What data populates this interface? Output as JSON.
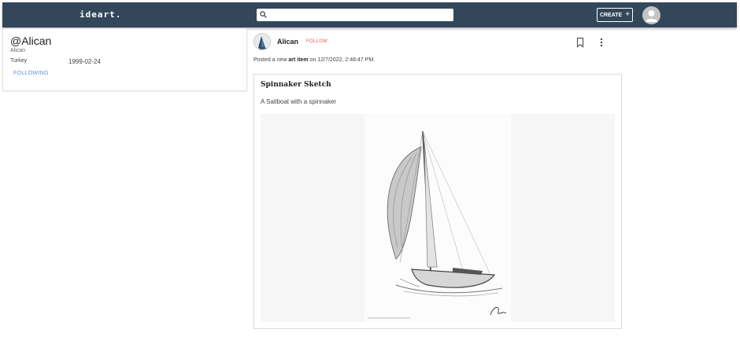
{
  "app": {
    "logo": "ideart."
  },
  "header": {
    "search_placeholder": "",
    "create_label": "CREATE",
    "create_plus": "+"
  },
  "profile": {
    "handle": "@Alican",
    "name": "Alican",
    "country": "Turkey",
    "birthdate": "1999-02-24",
    "following_label": "FOLLOWING"
  },
  "post": {
    "author": "Alican",
    "follow_label": "FOLLOW",
    "posted_prefix": "Posted a new",
    "item_type": "art item",
    "posted_on": "on 12/7/2022, 2:48:47 PM.",
    "art": {
      "title": "Spinnaker Sketch",
      "description": "A Sailboat with a spinnaker",
      "image_semantic": "sailboat-sketch-image"
    }
  },
  "colors": {
    "topbar": "#33475b",
    "following": "#5b8ed6",
    "follow": "#e2574c"
  },
  "icons": {
    "search": "search-icon",
    "avatar": "user-avatar-icon",
    "bookmark": "bookmark-icon",
    "more": "more-vert-icon"
  }
}
